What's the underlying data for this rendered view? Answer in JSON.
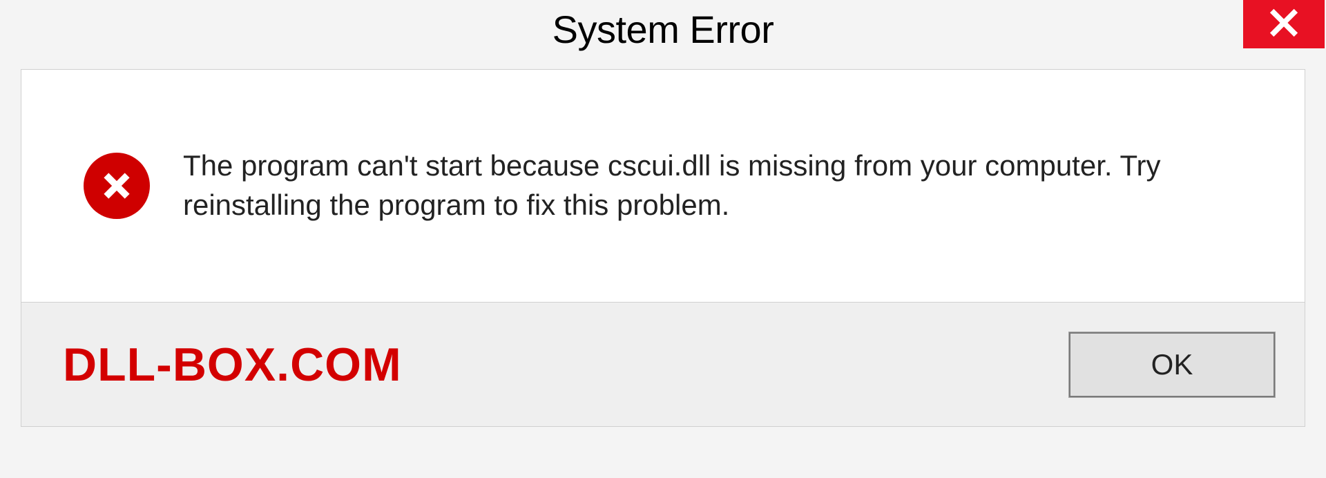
{
  "dialog": {
    "title": "System Error",
    "message": "The program can't start because cscui.dll is missing from your computer. Try reinstalling the program to fix this problem."
  },
  "footer": {
    "brand": "DLL-BOX.COM",
    "ok_label": "OK"
  }
}
